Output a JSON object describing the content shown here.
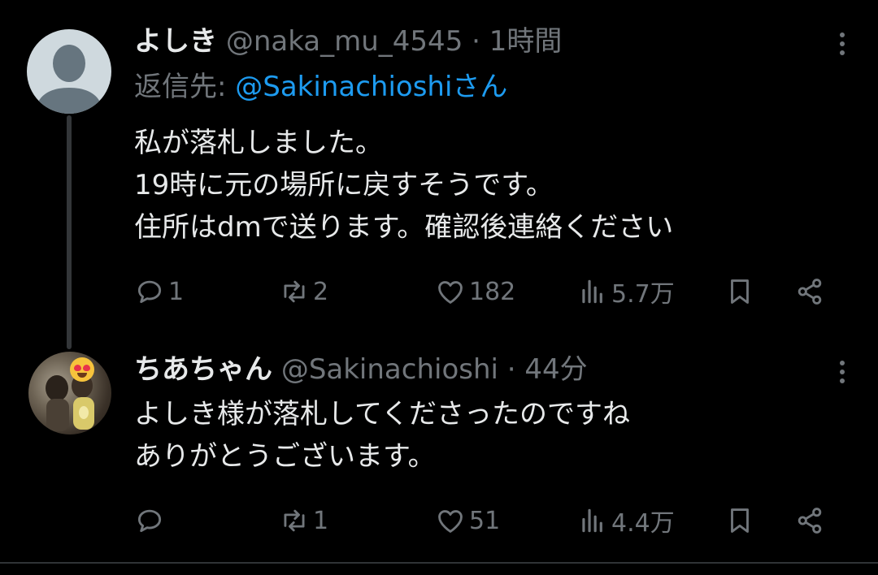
{
  "tweets": [
    {
      "name": "よしき",
      "handle": "@naka_mu_4545",
      "dot": "·",
      "time": "1時間",
      "reply_prefix": "返信先: ",
      "reply_mention": "@Sakinachioshi",
      "reply_suffix": "さん",
      "lines": [
        "私が落札しました。",
        "19時に元の場所に戻すそうです。",
        "住所はdmで送ります。確認後連絡ください"
      ],
      "stats": {
        "replies": "1",
        "reposts": "2",
        "likes": "182",
        "views": "5.7万"
      }
    },
    {
      "name": "ちあちゃん",
      "handle": "@Sakinachioshi",
      "dot": "·",
      "time": "44分",
      "lines": [
        "よしき様が落札してくださったのですね",
        "ありがとうございます。"
      ],
      "stats": {
        "replies": "",
        "reposts": "1",
        "likes": "51",
        "views": "4.4万"
      }
    }
  ],
  "colors": {
    "background": "#000000",
    "text": "#e7e9ea",
    "muted": "#71767b",
    "link": "#1d9bf0",
    "thread_line": "#333639"
  },
  "icons": [
    "reply-icon",
    "repost-icon",
    "like-icon",
    "views-icon",
    "bookmark-icon",
    "share-icon",
    "more-icon"
  ]
}
